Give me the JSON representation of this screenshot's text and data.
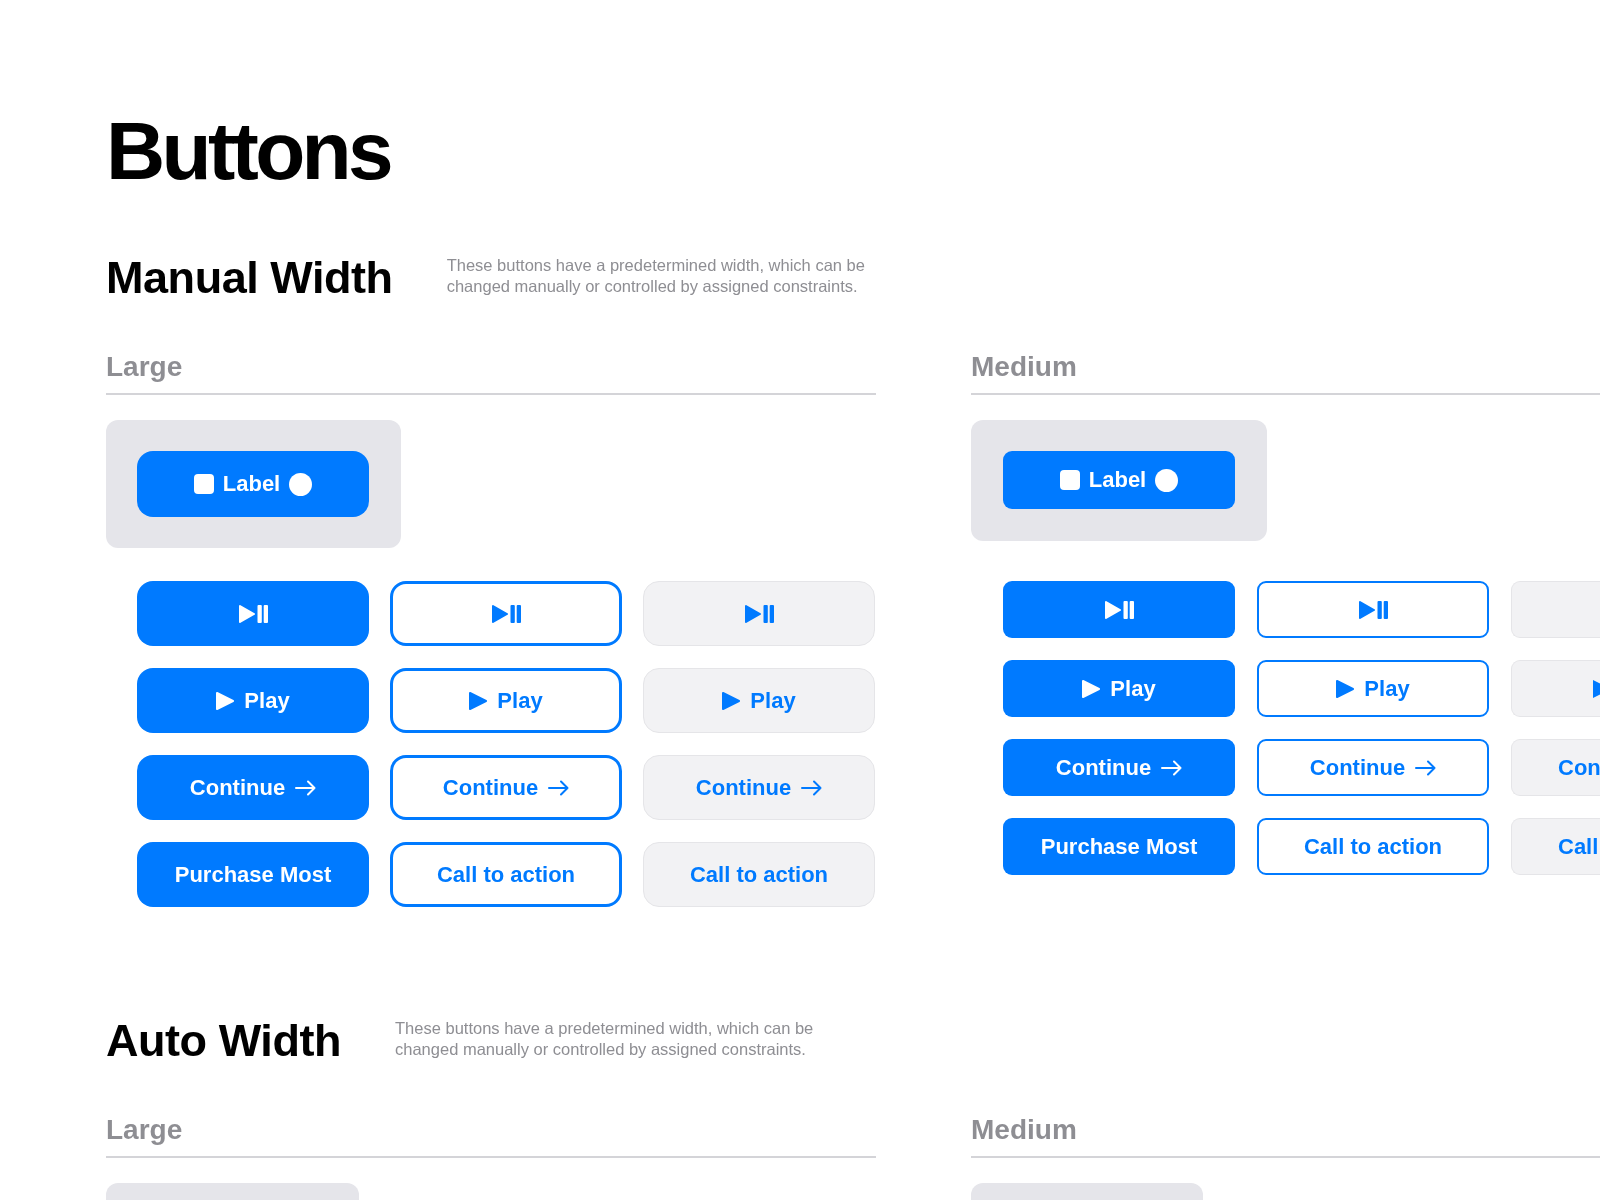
{
  "page_title": "Buttons",
  "sections": [
    {
      "title": "Manual Width",
      "description": "These buttons have a predetermined width, which can be changed manually or controlled by assigned constraints.",
      "groups": [
        {
          "label": "Large",
          "demo_button": {
            "label": "Label"
          },
          "rows": [
            [
              {
                "kind": "playpause",
                "cut_off": false
              },
              {
                "kind": "playpause",
                "cut_off": false
              },
              {
                "kind": "playpause",
                "cut_off": false
              }
            ],
            [
              {
                "kind": "play",
                "label": "Play",
                "cut_off": false
              },
              {
                "kind": "play",
                "label": "Play",
                "cut_off": false
              },
              {
                "kind": "play",
                "label": "Play",
                "cut_off": false
              }
            ],
            [
              {
                "kind": "arrow",
                "label": "Continue",
                "cut_off": false
              },
              {
                "kind": "arrow",
                "label": "Continue",
                "cut_off": false
              },
              {
                "kind": "arrow",
                "label": "Continue",
                "cut_off": false
              }
            ],
            [
              {
                "kind": "text",
                "label": "Purchase Most",
                "cut_off": false
              },
              {
                "kind": "text",
                "label": "Call to action",
                "cut_off": false
              },
              {
                "kind": "text",
                "label": "Call to action",
                "cut_off": false
              }
            ]
          ]
        },
        {
          "label": "Medium",
          "demo_button": {
            "label": "Label"
          },
          "rows": [
            [
              {
                "kind": "playpause",
                "cut_off": false
              },
              {
                "kind": "playpause",
                "cut_off": false
              },
              {
                "kind": "playpause",
                "cut_off": true
              }
            ],
            [
              {
                "kind": "play",
                "label": "Play",
                "cut_off": false
              },
              {
                "kind": "play",
                "label": "Play",
                "cut_off": false
              },
              {
                "kind": "play",
                "cut_off": true
              }
            ],
            [
              {
                "kind": "arrow",
                "label": "Continue",
                "cut_off": false
              },
              {
                "kind": "arrow",
                "label": "Continue",
                "cut_off": false
              },
              {
                "kind": "text",
                "label": "Con",
                "cut_off": true
              }
            ],
            [
              {
                "kind": "text",
                "label": "Purchase Most",
                "cut_off": false
              },
              {
                "kind": "text",
                "label": "Call to action",
                "cut_off": false
              },
              {
                "kind": "text",
                "label": "Call",
                "cut_off": true
              }
            ]
          ]
        }
      ]
    },
    {
      "title": "Auto Width",
      "description": "These buttons have a predetermined width, which can be changed manually or controlled by assigned constraints.",
      "groups": [
        {
          "label": "Large"
        },
        {
          "label": "Medium"
        }
      ]
    }
  ]
}
